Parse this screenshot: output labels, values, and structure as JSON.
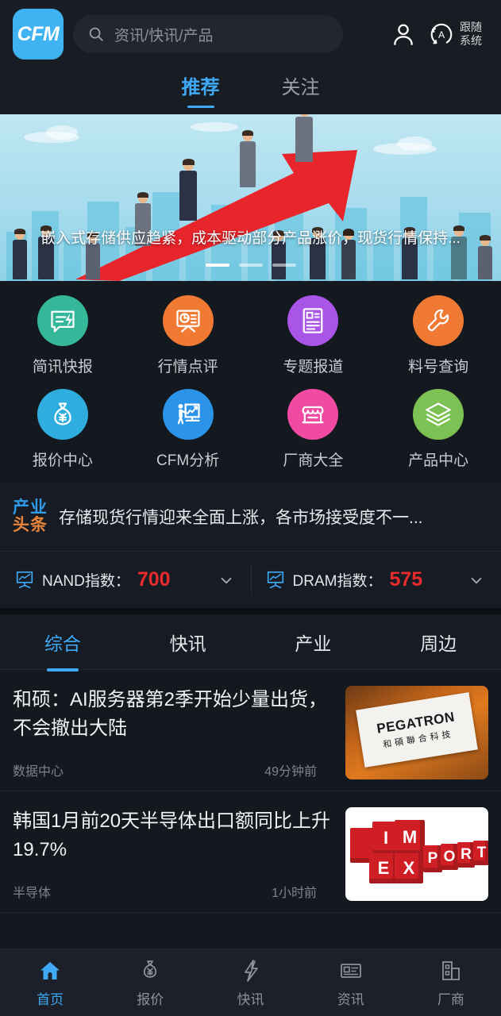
{
  "header": {
    "logo_text": "CFM",
    "search": {
      "placeholder": "资讯/快讯/产品",
      "icon": "search-icon"
    },
    "profile_icon": "user-icon",
    "theme_icon": "auto-theme-icon",
    "theme_label_line1": "跟随",
    "theme_label_line2": "系统"
  },
  "top_tabs": [
    {
      "label": "推荐",
      "active": true
    },
    {
      "label": "关注",
      "active": false
    }
  ],
  "banner": {
    "title": "嵌入式存储供应趋紧，成本驱动部分产品涨价，现货行情保持...",
    "slide_count": 3,
    "active_slide": 1
  },
  "grid": [
    {
      "label": "简讯快报",
      "icon": "news-flash-icon",
      "color": "#35b79a"
    },
    {
      "label": "行情点评",
      "icon": "market-review-icon",
      "color": "#f07a33"
    },
    {
      "label": "专题报道",
      "icon": "special-report-icon",
      "color": "#a855e8"
    },
    {
      "label": "料号查询",
      "icon": "part-number-search-icon",
      "color": "#f07a33"
    },
    {
      "label": "报价中心",
      "icon": "quote-center-icon",
      "color": "#2eadde"
    },
    {
      "label": "CFM分析",
      "icon": "cfm-analysis-icon",
      "color": "#2b93e8"
    },
    {
      "label": "厂商大全",
      "icon": "vendor-directory-icon",
      "color": "#ef4ba3"
    },
    {
      "label": "产品中心",
      "icon": "product-center-icon",
      "color": "#7cc153"
    }
  ],
  "headline": {
    "badge_line1": "产业",
    "badge_line2": "头条",
    "text": "存储现货行情迎来全面上涨，各市场接受度不一..."
  },
  "indexes": [
    {
      "name": "NAND指数：",
      "value": "700",
      "icon": "chart-board-icon",
      "chevron": "chevron-down-icon"
    },
    {
      "name": "DRAM指数：",
      "value": "575",
      "icon": "chart-board-icon",
      "chevron": "chevron-down-icon"
    }
  ],
  "content_tabs": [
    {
      "label": "综合",
      "active": true
    },
    {
      "label": "快讯",
      "active": false
    },
    {
      "label": "产业",
      "active": false
    },
    {
      "label": "周边",
      "active": false
    }
  ],
  "news": [
    {
      "title": "和硕：AI服务器第2季开始少量出货，不会撤出大陆",
      "source": "数据中心",
      "time": "49分钟前",
      "thumb": "pegatron-sign-photo",
      "thumb_text_en": "PEGATRON",
      "thumb_text_cn": "和碩聯合科技"
    },
    {
      "title": "韩国1月前20天半导体出口额同比上升19.7%",
      "source": "半导体",
      "time": "1小时前",
      "thumb": "import-export-blocks-photo",
      "thumb_blocks": [
        "I",
        "M",
        "E",
        "X",
        "P",
        "O",
        "R",
        "T"
      ]
    }
  ],
  "bottom_nav": [
    {
      "label": "首页",
      "icon": "home-icon",
      "active": true
    },
    {
      "label": "报价",
      "icon": "money-bag-icon",
      "active": false
    },
    {
      "label": "快讯",
      "icon": "lightning-icon",
      "active": false
    },
    {
      "label": "资讯",
      "icon": "news-card-icon",
      "active": false
    },
    {
      "label": "厂商",
      "icon": "building-icon",
      "active": false
    }
  ],
  "colors": {
    "accent": "#3fa9f5",
    "logo_bg": "#3fb3f2",
    "index_value": "#ea2b2b",
    "badge_blue": "#2f9ae8",
    "badge_orange": "#e8843a",
    "page_bg": "#0d0f14",
    "card_bg": "#171c24"
  }
}
